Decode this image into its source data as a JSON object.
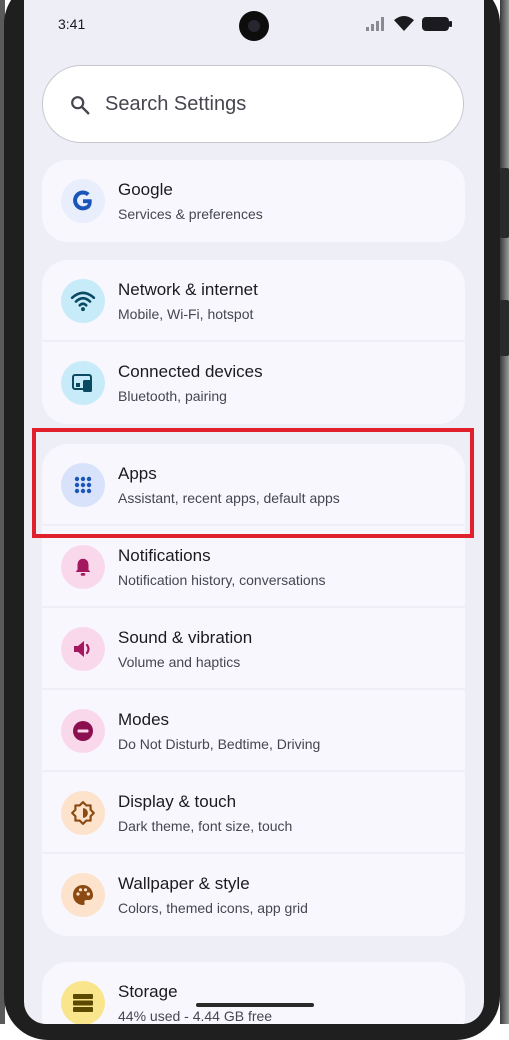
{
  "status_bar": {
    "time": "3:41"
  },
  "search": {
    "placeholder": "Search Settings"
  },
  "groups": [
    {
      "items": [
        {
          "id": "google",
          "title": "Google",
          "subtitle": "Services & preferences",
          "icon": "google-g-icon",
          "icon_bg": "#e8eefb"
        }
      ]
    },
    {
      "items": [
        {
          "id": "network",
          "title": "Network & internet",
          "subtitle": "Mobile, Wi-Fi, hotspot",
          "icon": "wifi-icon",
          "icon_bg": "#c7ebf9"
        },
        {
          "id": "connected",
          "title": "Connected devices",
          "subtitle": "Bluetooth, pairing",
          "icon": "devices-icon",
          "icon_bg": "#c7ebf9"
        }
      ]
    },
    {
      "items": [
        {
          "id": "apps",
          "title": "Apps",
          "subtitle": "Assistant, recent apps, default apps",
          "icon": "apps-grid-icon",
          "icon_bg": "#d8e3fb"
        },
        {
          "id": "notifications",
          "title": "Notifications",
          "subtitle": "Notification history, conversations",
          "icon": "bell-icon",
          "icon_bg": "#fad8ec"
        },
        {
          "id": "sound",
          "title": "Sound & vibration",
          "subtitle": "Volume and haptics",
          "icon": "speaker-icon",
          "icon_bg": "#fad8ec"
        },
        {
          "id": "modes",
          "title": "Modes",
          "subtitle": "Do Not Disturb, Bedtime, Driving",
          "icon": "do-not-disturb-icon",
          "icon_bg": "#fad8ec"
        },
        {
          "id": "display",
          "title": "Display & touch",
          "subtitle": "Dark theme, font size, touch",
          "icon": "brightness-icon",
          "icon_bg": "#fde2cc"
        },
        {
          "id": "wallpaper",
          "title": "Wallpaper & style",
          "subtitle": "Colors, themed icons, app grid",
          "icon": "palette-icon",
          "icon_bg": "#fde2cc"
        }
      ]
    },
    {
      "items": [
        {
          "id": "storage",
          "title": "Storage",
          "subtitle": "44% used - 4.44 GB free",
          "icon": "storage-icon",
          "icon_bg": "#f8e58c"
        }
      ]
    }
  ],
  "colors": {
    "accent_blue": "#1a56b8",
    "pink_icon": "#a3185f",
    "orange_icon": "#8a4a12",
    "highlight": "#e0202a"
  }
}
